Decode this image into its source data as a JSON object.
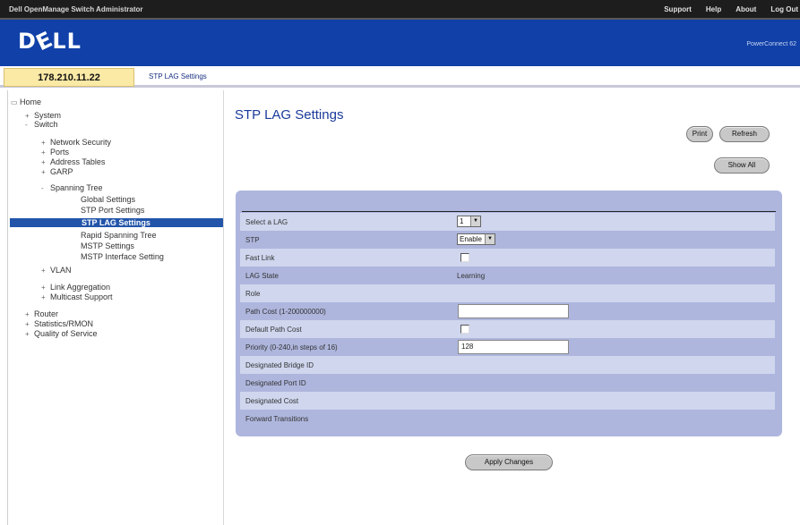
{
  "header": {
    "app_title": "Dell OpenManage Switch Administrator",
    "links": [
      "Support",
      "Help",
      "About",
      "Log Out"
    ],
    "logo": "DÉLL",
    "product": "PowerConnect 62"
  },
  "ip_address": "178.210.11.22",
  "breadcrumb": "STP LAG Settings",
  "tree": [
    {
      "label": "Home",
      "pm": "",
      "icon": "computer-icon"
    },
    {
      "label": "System",
      "pm": "+"
    },
    {
      "label": "Switch",
      "pm": "-"
    },
    {
      "label": "Network Security",
      "pm": "+"
    },
    {
      "label": "Ports",
      "pm": "+"
    },
    {
      "label": "Address Tables",
      "pm": "+"
    },
    {
      "label": "GARP",
      "pm": "+"
    },
    {
      "label": "Spanning Tree",
      "pm": "-"
    },
    {
      "label": "Global Settings",
      "pm": ""
    },
    {
      "label": "STP Port Settings",
      "pm": ""
    },
    {
      "label": "STP LAG Settings",
      "pm": "",
      "selected": true
    },
    {
      "label": "Rapid Spanning Tree",
      "pm": ""
    },
    {
      "label": "MSTP Settings",
      "pm": ""
    },
    {
      "label": "MSTP Interface Setting",
      "pm": ""
    },
    {
      "label": "VLAN",
      "pm": "+"
    },
    {
      "label": "Link Aggregation",
      "pm": "+"
    },
    {
      "label": "Multicast Support",
      "pm": "+"
    },
    {
      "label": "Router",
      "pm": "+"
    },
    {
      "label": "Statistics/RMON",
      "pm": "+"
    },
    {
      "label": "Quality of Service",
      "pm": "+"
    }
  ],
  "page_title": "STP LAG Settings",
  "buttons": {
    "print": "Print",
    "refresh": "Refresh",
    "show_all": "Show All",
    "apply": "Apply Changes"
  },
  "form": {
    "select_lag": {
      "label": "Select a LAG",
      "value": "1"
    },
    "stp": {
      "label": "STP",
      "value": "Enable"
    },
    "fast_link": {
      "label": "Fast Link"
    },
    "lag_state": {
      "label": "LAG State",
      "value": "Learning"
    },
    "role": {
      "label": "Role",
      "value": ""
    },
    "path_cost": {
      "label": "Path Cost (1-200000000)",
      "value": ""
    },
    "default_path_cost": {
      "label": "Default Path Cost"
    },
    "priority": {
      "label": "Priority (0-240,in steps of 16)",
      "value": "128"
    },
    "designated_bridge_id": {
      "label": "Designated Bridge ID",
      "value": ""
    },
    "designated_port_id": {
      "label": "Designated Port ID",
      "value": ""
    },
    "designated_cost": {
      "label": "Designated Cost",
      "value": ""
    },
    "forward_transitions": {
      "label": "Forward Transitions",
      "value": ""
    }
  }
}
